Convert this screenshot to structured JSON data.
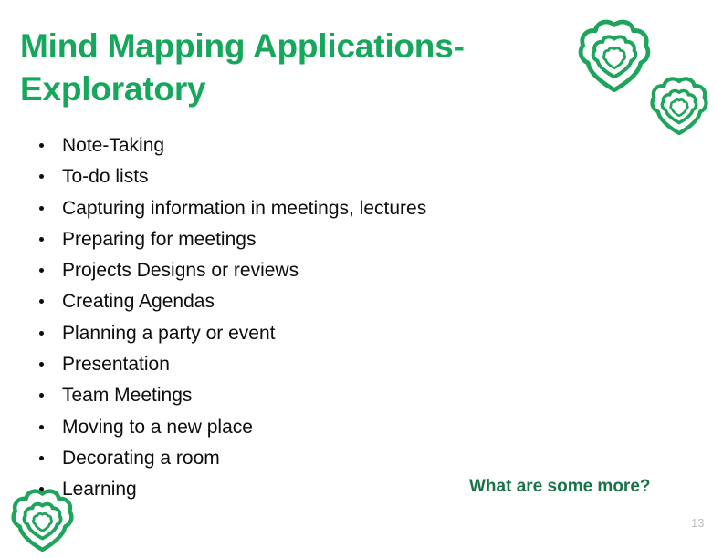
{
  "slide": {
    "title": "Mind Mapping Applications-\nExploratory",
    "page_number": "13",
    "question": "What are some more?",
    "colors": {
      "title_green": "#16A75C",
      "accent_dark_green": "#1A7348",
      "flower_green": "#1FA45C",
      "body_text": "#0D0D0D",
      "page_number_gray": "#BFBFBF",
      "background": "#FFFFFF"
    },
    "bullets": [
      {
        "label": "Note-Taking"
      },
      {
        "label": "To-do lists"
      },
      {
        "label": "Capturing information in meetings, lectures"
      },
      {
        "label": "Preparing for meetings"
      },
      {
        "label": "Projects Designs or reviews"
      },
      {
        "label": "Creating Agendas"
      },
      {
        "label": "Planning a party or event"
      },
      {
        "label": "Presentation"
      },
      {
        "label": "Team Meetings"
      },
      {
        "label": "Moving to a new place"
      },
      {
        "label": "Decorating a room"
      },
      {
        "label": "Learning"
      }
    ],
    "decorations": [
      {
        "name": "flower-logo-large"
      },
      {
        "name": "flower-logo-small"
      },
      {
        "name": "flower-logo-bottom-left"
      }
    ]
  }
}
